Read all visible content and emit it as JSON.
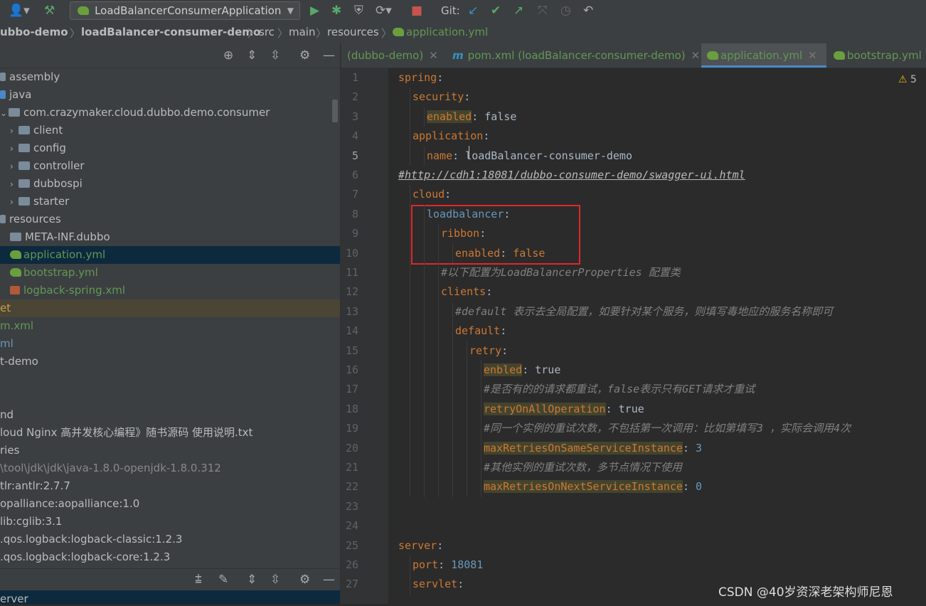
{
  "toolbar": {
    "run_config": "LoadBalancerConsumerApplication",
    "git_label": "Git:"
  },
  "breadcrumb": [
    "dubbo-demo",
    "loadBalancer-consumer-demo",
    "src",
    "main",
    "resources",
    "application.yml"
  ],
  "tabs": [
    {
      "label": "(dubbo-demo)",
      "active": false
    },
    {
      "label": "pom.xml (loadBalancer-consumer-demo)",
      "active": false
    },
    {
      "label": "application.yml",
      "active": true
    },
    {
      "label": "bootstrap.yml",
      "active": false
    }
  ],
  "tree": {
    "items": [
      {
        "label": "assembly",
        "indent": 0,
        "kind": "folder"
      },
      {
        "label": "java",
        "indent": 0,
        "kind": "folder-blue"
      },
      {
        "label": "com.crazymaker.cloud.dubbo.demo.consumer",
        "indent": 1,
        "kind": "package"
      },
      {
        "label": "client",
        "indent": 2,
        "kind": "package"
      },
      {
        "label": "config",
        "indent": 2,
        "kind": "package"
      },
      {
        "label": "controller",
        "indent": 2,
        "kind": "package"
      },
      {
        "label": "dubbospi",
        "indent": 2,
        "kind": "package"
      },
      {
        "label": "starter",
        "indent": 2,
        "kind": "package"
      },
      {
        "label": "resources",
        "indent": 0,
        "kind": "folder"
      },
      {
        "label": "META-INF.dubbo",
        "indent": 1,
        "kind": "folder"
      },
      {
        "label": "application.yml",
        "indent": 1,
        "kind": "yml",
        "selected": true
      },
      {
        "label": "bootstrap.yml",
        "indent": 1,
        "kind": "yml"
      },
      {
        "label": "logback-spring.xml",
        "indent": 1,
        "kind": "xml"
      },
      {
        "label": "et",
        "indent": 0,
        "kind": "text-yellow",
        "highlight": true
      },
      {
        "label": "m.xml",
        "indent": 0,
        "kind": "text-green"
      },
      {
        "label": "ml",
        "indent": 0,
        "kind": "text-blue"
      },
      {
        "label": "t-demo",
        "indent": 0,
        "kind": "text"
      },
      {
        "label": "",
        "indent": 0,
        "kind": "text"
      },
      {
        "label": "nd",
        "indent": 0,
        "kind": "text"
      },
      {
        "label": "loud Nginx 高并发核心编程》随书源码 使用说明.txt",
        "indent": 0,
        "kind": "text"
      },
      {
        "label": "ries",
        "indent": 0,
        "kind": "text"
      },
      {
        "label": "\\tool\\jdk\\jdk\\java-1.8.0-openjdk-1.8.0.312",
        "indent": 0,
        "kind": "text-gray"
      },
      {
        "label": "tlr:antlr:2.7.7",
        "indent": 0,
        "kind": "text"
      },
      {
        "label": "opalliance:aopalliance:1.0",
        "indent": 0,
        "kind": "text"
      },
      {
        "label": "lib:cglib:3.1",
        "indent": 0,
        "kind": "text"
      },
      {
        "label": ".qos.logback:logback-classic:1.2.3",
        "indent": 0,
        "kind": "text"
      },
      {
        "label": ".qos.logback:logback-core:1.2.3",
        "indent": 0,
        "kind": "text"
      }
    ],
    "bottom_label": "erver"
  },
  "editor": {
    "warning": "5",
    "lines": [
      {
        "n": "1",
        "segs": [
          [
            "k",
            "spring"
          ],
          [
            "v",
            ":"
          ]
        ],
        "indent": 0
      },
      {
        "n": "2",
        "segs": [
          [
            "k",
            "security"
          ],
          [
            "v",
            ":"
          ]
        ],
        "indent": 1
      },
      {
        "n": "3",
        "segs": [
          [
            "k hl",
            "enabled"
          ],
          [
            "v",
            ": false"
          ]
        ],
        "indent": 2
      },
      {
        "n": "4",
        "segs": [
          [
            "k",
            "application"
          ],
          [
            "v",
            ":"
          ]
        ],
        "indent": 1
      },
      {
        "n": "5",
        "segs": [
          [
            "k",
            "name"
          ],
          [
            "v",
            ": loadBalancer-consumer-demo"
          ]
        ],
        "indent": 2
      },
      {
        "n": "6",
        "segs": [
          [
            "c",
            "#http://cdh1:18081/dubbo-consumer-demo/swagger-ui.html"
          ]
        ],
        "indent": 0
      },
      {
        "n": "7",
        "segs": [
          [
            "k",
            "cloud"
          ],
          [
            "v",
            ":"
          ]
        ],
        "indent": 1
      },
      {
        "n": "8",
        "segs": [
          [
            "kb",
            "loadbalancer"
          ],
          [
            "v",
            ":"
          ]
        ],
        "indent": 2
      },
      {
        "n": "9",
        "segs": [
          [
            "k",
            "ribbon"
          ],
          [
            "v",
            ":"
          ]
        ],
        "indent": 3
      },
      {
        "n": "10",
        "segs": [
          [
            "k",
            "enabled"
          ],
          [
            "v",
            ": "
          ],
          [
            "k",
            "false"
          ]
        ],
        "indent": 4
      },
      {
        "n": "11",
        "segs": [
          [
            "c",
            "#以下配置为LoadBalancerProperties 配置类"
          ]
        ],
        "indent": 3
      },
      {
        "n": "12",
        "segs": [
          [
            "k",
            "clients"
          ],
          [
            "v",
            ":"
          ]
        ],
        "indent": 3
      },
      {
        "n": "13",
        "segs": [
          [
            "c",
            "#default 表示去全局配置，如要针对某个服务，则填写毒地应的服务名称即可"
          ]
        ],
        "indent": 4
      },
      {
        "n": "14",
        "segs": [
          [
            "k",
            "default"
          ],
          [
            "v",
            ":"
          ]
        ],
        "indent": 4
      },
      {
        "n": "15",
        "segs": [
          [
            "k",
            "retry"
          ],
          [
            "v",
            ":"
          ]
        ],
        "indent": 5
      },
      {
        "n": "16",
        "segs": [
          [
            "k hl",
            "enbled"
          ],
          [
            "v",
            ": true"
          ]
        ],
        "indent": 6
      },
      {
        "n": "17",
        "segs": [
          [
            "c",
            "#是否有的的请求都重试，false表示只有GET请求才重试"
          ]
        ],
        "indent": 6
      },
      {
        "n": "18",
        "segs": [
          [
            "k hl",
            "retryOnAllOperation"
          ],
          [
            "v",
            ": true"
          ]
        ],
        "indent": 6
      },
      {
        "n": "19",
        "segs": [
          [
            "c",
            "#同一个实例的重试次数，不包括第一次调用：比如第填写3 ，实际会调用4次"
          ]
        ],
        "indent": 6
      },
      {
        "n": "20",
        "segs": [
          [
            "k hl",
            "maxRetriesOnSameServiceInstance"
          ],
          [
            "v",
            ": "
          ],
          [
            "num",
            "3"
          ]
        ],
        "indent": 6
      },
      {
        "n": "21",
        "segs": [
          [
            "c",
            "#其他实例的重试次数，多节点情况下使用"
          ]
        ],
        "indent": 6
      },
      {
        "n": "22",
        "segs": [
          [
            "k hl",
            "maxRetriesOnNextServiceInstance"
          ],
          [
            "v",
            ": "
          ],
          [
            "num",
            "0"
          ]
        ],
        "indent": 6
      },
      {
        "n": "23",
        "segs": [],
        "indent": 0
      },
      {
        "n": "24",
        "segs": [],
        "indent": 0
      },
      {
        "n": "25",
        "segs": [
          [
            "k",
            "server"
          ],
          [
            "v",
            ":"
          ]
        ],
        "indent": 0
      },
      {
        "n": "26",
        "segs": [
          [
            "k",
            "port"
          ],
          [
            "v",
            ": "
          ],
          [
            "num",
            "18081"
          ]
        ],
        "indent": 1
      },
      {
        "n": "27",
        "segs": [
          [
            "k",
            "servlet"
          ],
          [
            "v",
            ":"
          ]
        ],
        "indent": 1
      }
    ]
  },
  "watermark": "CSDN @40岁资深老架构师尼恩"
}
